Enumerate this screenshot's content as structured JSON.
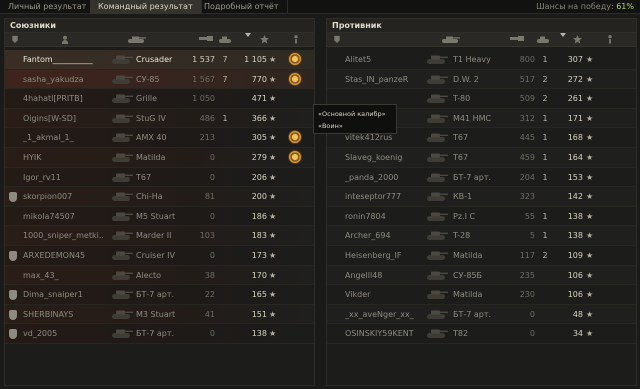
{
  "tabs": [
    {
      "label": "Личный результат",
      "active": false
    },
    {
      "label": "Командный результат",
      "active": true
    },
    {
      "label": "Подробный отчёт",
      "active": false
    }
  ],
  "chance": {
    "label": "Шансы на победу:",
    "value": "61%"
  },
  "allies": {
    "title": "Союзники",
    "rows": [
      {
        "name": "Fantom__________",
        "vehicle": "Crusader",
        "damage": "1 537",
        "frags": "7",
        "xp": "1 105",
        "squad": false,
        "medal": true,
        "me": true
      },
      {
        "name": "sasha_yakudza",
        "vehicle": "СУ-85",
        "damage": "1 567",
        "frags": "7",
        "xp": "770",
        "squad": false,
        "medal": true,
        "sel": true
      },
      {
        "name": "4hahatl[PRITB]",
        "vehicle": "Grille",
        "damage": "1 050",
        "frags": "",
        "xp": "471",
        "squad": false,
        "medal": false
      },
      {
        "name": "Oigins[W-SD]",
        "vehicle": "StuG IV",
        "damage": "486",
        "frags": "1",
        "xp": "366",
        "squad": false,
        "medal": false
      },
      {
        "name": "_1_akmal_1_",
        "vehicle": "AMX 40",
        "damage": "213",
        "frags": "",
        "xp": "305",
        "squad": false,
        "medal": true
      },
      {
        "name": "HYIK",
        "vehicle": "Matilda",
        "damage": "0",
        "frags": "",
        "xp": "279",
        "squad": false,
        "medal": true
      },
      {
        "name": "Igor_rv11",
        "vehicle": "T67",
        "damage": "0",
        "frags": "",
        "xp": "206",
        "squad": false,
        "medal": false
      },
      {
        "name": "skorpion007",
        "vehicle": "Chi-Ha",
        "damage": "81",
        "frags": "",
        "xp": "200",
        "squad": true,
        "medal": false
      },
      {
        "name": "mikola74507",
        "vehicle": "M5 Stuart",
        "damage": "0",
        "frags": "",
        "xp": "186",
        "squad": false,
        "medal": false
      },
      {
        "name": "1000_sniper_metki...",
        "vehicle": "Marder II",
        "damage": "103",
        "frags": "",
        "xp": "183",
        "squad": false,
        "medal": false
      },
      {
        "name": "ARXEDEMON45",
        "vehicle": "Cruiser IV",
        "damage": "0",
        "frags": "",
        "xp": "173",
        "squad": true,
        "medal": false
      },
      {
        "name": "max_43_",
        "vehicle": "Alecto",
        "damage": "38",
        "frags": "",
        "xp": "170",
        "squad": false,
        "medal": false
      },
      {
        "name": "Dima_snaiper1",
        "vehicle": "БТ-7 арт.",
        "damage": "22",
        "frags": "",
        "xp": "165",
        "squad": true,
        "medal": false
      },
      {
        "name": "SHERBINAYS",
        "vehicle": "M3 Stuart",
        "damage": "41",
        "frags": "",
        "xp": "151",
        "squad": true,
        "medal": false
      },
      {
        "name": "vd_2005",
        "vehicle": "БТ-7 арт.",
        "damage": "0",
        "frags": "",
        "xp": "138",
        "squad": true,
        "medal": false
      }
    ]
  },
  "enemies": {
    "title": "Противник",
    "rows": [
      {
        "name": "Alitet5",
        "vehicle": "T1 Heavy",
        "damage": "800",
        "frags": "1",
        "xp": "307"
      },
      {
        "name": "Stas_IN_panzeR",
        "vehicle": "D.W. 2",
        "damage": "517",
        "frags": "2",
        "xp": "272"
      },
      {
        "name": "",
        "vehicle": "T-80",
        "damage": "509",
        "frags": "2",
        "xp": "261"
      },
      {
        "name": "",
        "vehicle": "M41 HMC",
        "damage": "312",
        "frags": "1",
        "xp": "171"
      },
      {
        "name": "vitek412rus",
        "vehicle": "T67",
        "damage": "445",
        "frags": "1",
        "xp": "168"
      },
      {
        "name": "Slaveg_koenig",
        "vehicle": "T67",
        "damage": "459",
        "frags": "1",
        "xp": "164"
      },
      {
        "name": "_panda_2000",
        "vehicle": "БТ-7 арт.",
        "damage": "204",
        "frags": "1",
        "xp": "153"
      },
      {
        "name": "inteseptor777",
        "vehicle": "КВ-1",
        "damage": "323",
        "frags": "",
        "xp": "142"
      },
      {
        "name": "ronin7804",
        "vehicle": "Pz.I C",
        "damage": "55",
        "frags": "1",
        "xp": "138"
      },
      {
        "name": "Archer_694",
        "vehicle": "T-28",
        "damage": "5",
        "frags": "1",
        "xp": "138"
      },
      {
        "name": "Heisenberg_IF",
        "vehicle": "Matilda",
        "damage": "117",
        "frags": "2",
        "xp": "109"
      },
      {
        "name": "Angelll48",
        "vehicle": "СУ-85Б",
        "damage": "235",
        "frags": "",
        "xp": "106"
      },
      {
        "name": "Vikder",
        "vehicle": "Matilda",
        "damage": "230",
        "frags": "",
        "xp": "106"
      },
      {
        "name": "_xx_aveNger_xx_",
        "vehicle": "БТ-7 арт.",
        "damage": "0",
        "frags": "",
        "xp": "48"
      },
      {
        "name": "OSINSKIY59KENT",
        "vehicle": "T82",
        "damage": "0",
        "frags": "",
        "xp": "34"
      }
    ]
  },
  "tooltip": {
    "line1": "«Основной калибр»",
    "line2": "«Воин»"
  },
  "colors": {
    "accent": "#b5d36a",
    "ally_tint": "#2a1c17",
    "text": "#a9a79c"
  },
  "icons": {
    "squad": "squad-shield-icon",
    "player": "player-icon",
    "tank": "tank-icon",
    "damage": "damage-gun-icon",
    "frags": "frags-tank-icon",
    "xp": "xp-star-icon",
    "medal": "medal-icon",
    "sort": "sort-arrow-icon"
  }
}
